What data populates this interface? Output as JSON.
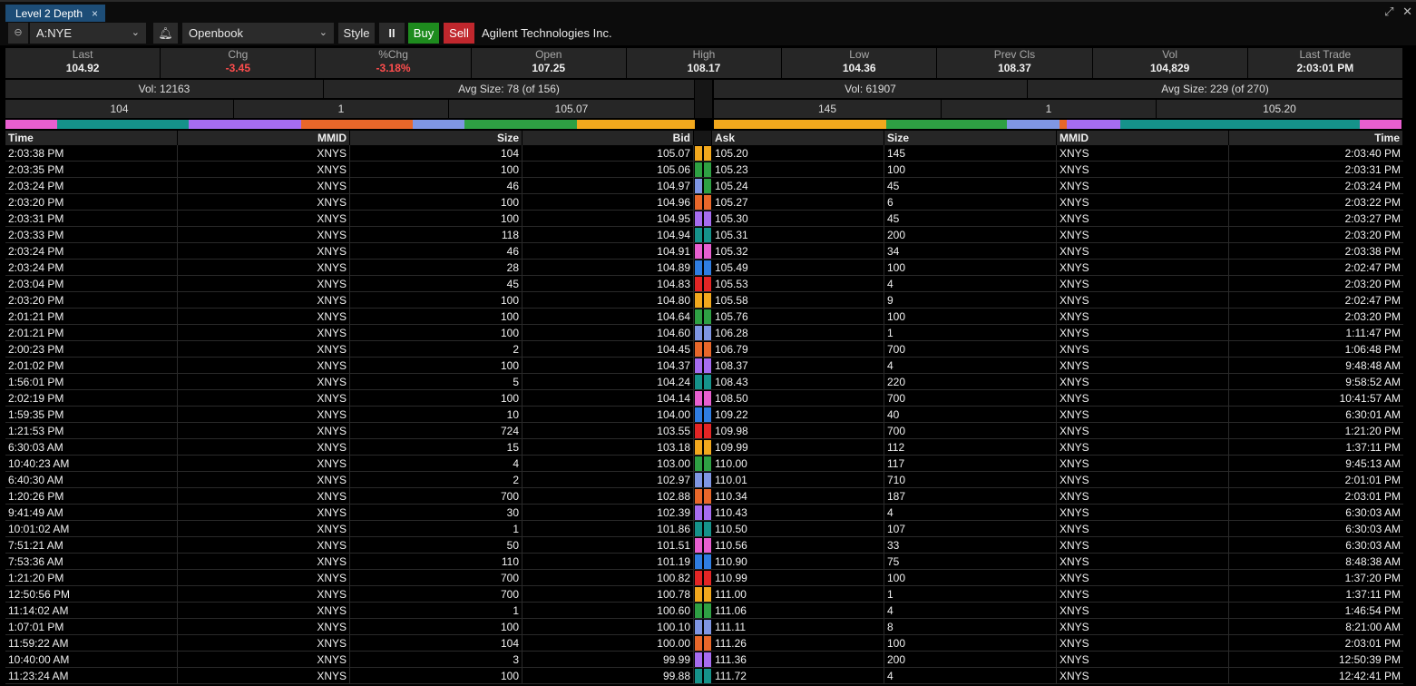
{
  "tab": {
    "title": "Level 2 Depth",
    "close": "×"
  },
  "window_controls": {
    "expand": "⤢",
    "close": "✕"
  },
  "toolbar": {
    "symbol": "A:NYE",
    "book": "Openbook",
    "style_label": "Style",
    "pause_label": "II",
    "buy_label": "Buy",
    "sell_label": "Sell",
    "company": "Agilent Technologies Inc."
  },
  "quote": [
    {
      "label": "Last",
      "value": "104.92",
      "neg": false
    },
    {
      "label": "Chg",
      "value": "-3.45",
      "neg": true
    },
    {
      "label": "%Chg",
      "value": "-3.18%",
      "neg": true
    },
    {
      "label": "Open",
      "value": "107.25",
      "neg": false
    },
    {
      "label": "High",
      "value": "108.17",
      "neg": false
    },
    {
      "label": "Low",
      "value": "104.36",
      "neg": false
    },
    {
      "label": "Prev Cls",
      "value": "108.37",
      "neg": false
    },
    {
      "label": "Vol",
      "value": "104,829",
      "neg": false
    },
    {
      "label": "Last Trade",
      "value": "2:03:01 PM",
      "neg": false
    }
  ],
  "bid_stats": {
    "vol": "Vol: 12163",
    "avg": "Avg Size: 78 (of 156)",
    "size": "104",
    "count": "1",
    "price": "105.07"
  },
  "ask_stats": {
    "vol": "Vol: 61907",
    "avg": "Avg Size: 229 (of 270)",
    "size": "145",
    "count": "1",
    "price": "105.20"
  },
  "colors": {
    "orange": "#f2a81d",
    "green": "#2ea043",
    "blue": "#7f96e3",
    "coral": "#e8672a",
    "purple": "#a66cf0",
    "teal": "#15928a",
    "pink": "#e85fd0",
    "azure": "#2f7de1",
    "red": "#e32525"
  },
  "bid_colorbar": [
    {
      "c": "#e85fd0",
      "w": 57
    },
    {
      "c": "#15928a",
      "w": 145
    },
    {
      "c": "#a66cf0",
      "w": 124
    },
    {
      "c": "#e8672a",
      "w": 123
    },
    {
      "c": "#7f96e3",
      "w": 57
    },
    {
      "c": "#2ea043",
      "w": 124
    },
    {
      "c": "#f2a81d",
      "w": 130
    }
  ],
  "ask_colorbar": [
    {
      "c": "#f2a81d",
      "w": 190
    },
    {
      "c": "#2ea043",
      "w": 133
    },
    {
      "c": "#7f96e3",
      "w": 58
    },
    {
      "c": "#e8672a",
      "w": 8
    },
    {
      "c": "#a66cf0",
      "w": 59
    },
    {
      "c": "#15928a",
      "w": 264
    },
    {
      "c": "#e85fd0",
      "w": 46
    }
  ],
  "headers": {
    "bid_time": "Time",
    "bid_mmid": "MMID",
    "bid_size": "Size",
    "bid": "Bid",
    "ask": "Ask",
    "ask_size": "Size",
    "ask_mmid": "MMID",
    "ask_time": "Time"
  },
  "rows": [
    {
      "bt": "2:03:38 PM",
      "bm": "XNYS",
      "bs": "104",
      "bp": "105.07",
      "bc": "#f2a81d",
      "ac": "#f2a81d",
      "ap": "105.20",
      "as": "145",
      "am": "XNYS",
      "at": "2:03:40 PM"
    },
    {
      "bt": "2:03:35 PM",
      "bm": "XNYS",
      "bs": "100",
      "bp": "105.06",
      "bc": "#2ea043",
      "ac": "#2ea043",
      "ap": "105.23",
      "as": "100",
      "am": "XNYS",
      "at": "2:03:31 PM"
    },
    {
      "bt": "2:03:24 PM",
      "bm": "XNYS",
      "bs": "46",
      "bp": "104.97",
      "bc": "#7f96e3",
      "ac": "#2ea043",
      "ap": "105.24",
      "as": "45",
      "am": "XNYS",
      "at": "2:03:24 PM"
    },
    {
      "bt": "2:03:20 PM",
      "bm": "XNYS",
      "bs": "100",
      "bp": "104.96",
      "bc": "#e8672a",
      "ac": "#e8672a",
      "ap": "105.27",
      "as": "6",
      "am": "XNYS",
      "at": "2:03:22 PM"
    },
    {
      "bt": "2:03:31 PM",
      "bm": "XNYS",
      "bs": "100",
      "bp": "104.95",
      "bc": "#a66cf0",
      "ac": "#a66cf0",
      "ap": "105.30",
      "as": "45",
      "am": "XNYS",
      "at": "2:03:27 PM"
    },
    {
      "bt": "2:03:33 PM",
      "bm": "XNYS",
      "bs": "118",
      "bp": "104.94",
      "bc": "#15928a",
      "ac": "#15928a",
      "ap": "105.31",
      "as": "200",
      "am": "XNYS",
      "at": "2:03:20 PM"
    },
    {
      "bt": "2:03:24 PM",
      "bm": "XNYS",
      "bs": "46",
      "bp": "104.91",
      "bc": "#e85fd0",
      "ac": "#e85fd0",
      "ap": "105.32",
      "as": "34",
      "am": "XNYS",
      "at": "2:03:38 PM"
    },
    {
      "bt": "2:03:24 PM",
      "bm": "XNYS",
      "bs": "28",
      "bp": "104.89",
      "bc": "#2f7de1",
      "ac": "#2f7de1",
      "ap": "105.49",
      "as": "100",
      "am": "XNYS",
      "at": "2:02:47 PM"
    },
    {
      "bt": "2:03:04 PM",
      "bm": "XNYS",
      "bs": "45",
      "bp": "104.83",
      "bc": "#e32525",
      "ac": "#e32525",
      "ap": "105.53",
      "as": "4",
      "am": "XNYS",
      "at": "2:03:20 PM"
    },
    {
      "bt": "2:03:20 PM",
      "bm": "XNYS",
      "bs": "100",
      "bp": "104.80",
      "bc": "#f2a81d",
      "ac": "#f2a81d",
      "ap": "105.58",
      "as": "9",
      "am": "XNYS",
      "at": "2:02:47 PM"
    },
    {
      "bt": "2:01:21 PM",
      "bm": "XNYS",
      "bs": "100",
      "bp": "104.64",
      "bc": "#2ea043",
      "ac": "#2ea043",
      "ap": "105.76",
      "as": "100",
      "am": "XNYS",
      "at": "2:03:20 PM"
    },
    {
      "bt": "2:01:21 PM",
      "bm": "XNYS",
      "bs": "100",
      "bp": "104.60",
      "bc": "#7f96e3",
      "ac": "#7f96e3",
      "ap": "106.28",
      "as": "1",
      "am": "XNYS",
      "at": "1:11:47 PM"
    },
    {
      "bt": "2:00:23 PM",
      "bm": "XNYS",
      "bs": "2",
      "bp": "104.45",
      "bc": "#e8672a",
      "ac": "#e8672a",
      "ap": "106.79",
      "as": "700",
      "am": "XNYS",
      "at": "1:06:48 PM"
    },
    {
      "bt": "2:01:02 PM",
      "bm": "XNYS",
      "bs": "100",
      "bp": "104.37",
      "bc": "#a66cf0",
      "ac": "#a66cf0",
      "ap": "108.37",
      "as": "4",
      "am": "XNYS",
      "at": "9:48:48 AM"
    },
    {
      "bt": "1:56:01 PM",
      "bm": "XNYS",
      "bs": "5",
      "bp": "104.24",
      "bc": "#15928a",
      "ac": "#15928a",
      "ap": "108.43",
      "as": "220",
      "am": "XNYS",
      "at": "9:58:52 AM"
    },
    {
      "bt": "2:02:19 PM",
      "bm": "XNYS",
      "bs": "100",
      "bp": "104.14",
      "bc": "#e85fd0",
      "ac": "#e85fd0",
      "ap": "108.50",
      "as": "700",
      "am": "XNYS",
      "at": "10:41:57 AM"
    },
    {
      "bt": "1:59:35 PM",
      "bm": "XNYS",
      "bs": "10",
      "bp": "104.00",
      "bc": "#2f7de1",
      "ac": "#2f7de1",
      "ap": "109.22",
      "as": "40",
      "am": "XNYS",
      "at": "6:30:01 AM"
    },
    {
      "bt": "1:21:53 PM",
      "bm": "XNYS",
      "bs": "724",
      "bp": "103.55",
      "bc": "#e32525",
      "ac": "#e32525",
      "ap": "109.98",
      "as": "700",
      "am": "XNYS",
      "at": "1:21:20 PM"
    },
    {
      "bt": "6:30:03 AM",
      "bm": "XNYS",
      "bs": "15",
      "bp": "103.18",
      "bc": "#f2a81d",
      "ac": "#f2a81d",
      "ap": "109.99",
      "as": "112",
      "am": "XNYS",
      "at": "1:37:11 PM"
    },
    {
      "bt": "10:40:23 AM",
      "bm": "XNYS",
      "bs": "4",
      "bp": "103.00",
      "bc": "#2ea043",
      "ac": "#2ea043",
      "ap": "110.00",
      "as": "117",
      "am": "XNYS",
      "at": "9:45:13 AM"
    },
    {
      "bt": "6:40:30 AM",
      "bm": "XNYS",
      "bs": "2",
      "bp": "102.97",
      "bc": "#7f96e3",
      "ac": "#7f96e3",
      "ap": "110.01",
      "as": "710",
      "am": "XNYS",
      "at": "2:01:01 PM"
    },
    {
      "bt": "1:20:26 PM",
      "bm": "XNYS",
      "bs": "700",
      "bp": "102.88",
      "bc": "#e8672a",
      "ac": "#e8672a",
      "ap": "110.34",
      "as": "187",
      "am": "XNYS",
      "at": "2:03:01 PM"
    },
    {
      "bt": "9:41:49 AM",
      "bm": "XNYS",
      "bs": "30",
      "bp": "102.39",
      "bc": "#a66cf0",
      "ac": "#a66cf0",
      "ap": "110.43",
      "as": "4",
      "am": "XNYS",
      "at": "6:30:03 AM"
    },
    {
      "bt": "10:01:02 AM",
      "bm": "XNYS",
      "bs": "1",
      "bp": "101.86",
      "bc": "#15928a",
      "ac": "#15928a",
      "ap": "110.50",
      "as": "107",
      "am": "XNYS",
      "at": "6:30:03 AM"
    },
    {
      "bt": "7:51:21 AM",
      "bm": "XNYS",
      "bs": "50",
      "bp": "101.51",
      "bc": "#e85fd0",
      "ac": "#e85fd0",
      "ap": "110.56",
      "as": "33",
      "am": "XNYS",
      "at": "6:30:03 AM"
    },
    {
      "bt": "7:53:36 AM",
      "bm": "XNYS",
      "bs": "110",
      "bp": "101.19",
      "bc": "#2f7de1",
      "ac": "#2f7de1",
      "ap": "110.90",
      "as": "75",
      "am": "XNYS",
      "at": "8:48:38 AM"
    },
    {
      "bt": "1:21:20 PM",
      "bm": "XNYS",
      "bs": "700",
      "bp": "100.82",
      "bc": "#e32525",
      "ac": "#e32525",
      "ap": "110.99",
      "as": "100",
      "am": "XNYS",
      "at": "1:37:20 PM"
    },
    {
      "bt": "12:50:56 PM",
      "bm": "XNYS",
      "bs": "700",
      "bp": "100.78",
      "bc": "#f2a81d",
      "ac": "#f2a81d",
      "ap": "111.00",
      "as": "1",
      "am": "XNYS",
      "at": "1:37:11 PM"
    },
    {
      "bt": "11:14:02 AM",
      "bm": "XNYS",
      "bs": "1",
      "bp": "100.60",
      "bc": "#2ea043",
      "ac": "#2ea043",
      "ap": "111.06",
      "as": "4",
      "am": "XNYS",
      "at": "1:46:54 PM"
    },
    {
      "bt": "1:07:01 PM",
      "bm": "XNYS",
      "bs": "100",
      "bp": "100.10",
      "bc": "#7f96e3",
      "ac": "#7f96e3",
      "ap": "111.11",
      "as": "8",
      "am": "XNYS",
      "at": "8:21:00 AM"
    },
    {
      "bt": "11:59:22 AM",
      "bm": "XNYS",
      "bs": "104",
      "bp": "100.00",
      "bc": "#e8672a",
      "ac": "#e8672a",
      "ap": "111.26",
      "as": "100",
      "am": "XNYS",
      "at": "2:03:01 PM"
    },
    {
      "bt": "10:40:00 AM",
      "bm": "XNYS",
      "bs": "3",
      "bp": "99.99",
      "bc": "#a66cf0",
      "ac": "#a66cf0",
      "ap": "111.36",
      "as": "200",
      "am": "XNYS",
      "at": "12:50:39 PM"
    },
    {
      "bt": "11:23:24 AM",
      "bm": "XNYS",
      "bs": "100",
      "bp": "99.88",
      "bc": "#15928a",
      "ac": "#15928a",
      "ap": "111.72",
      "as": "4",
      "am": "XNYS",
      "at": "12:42:41 PM"
    }
  ]
}
